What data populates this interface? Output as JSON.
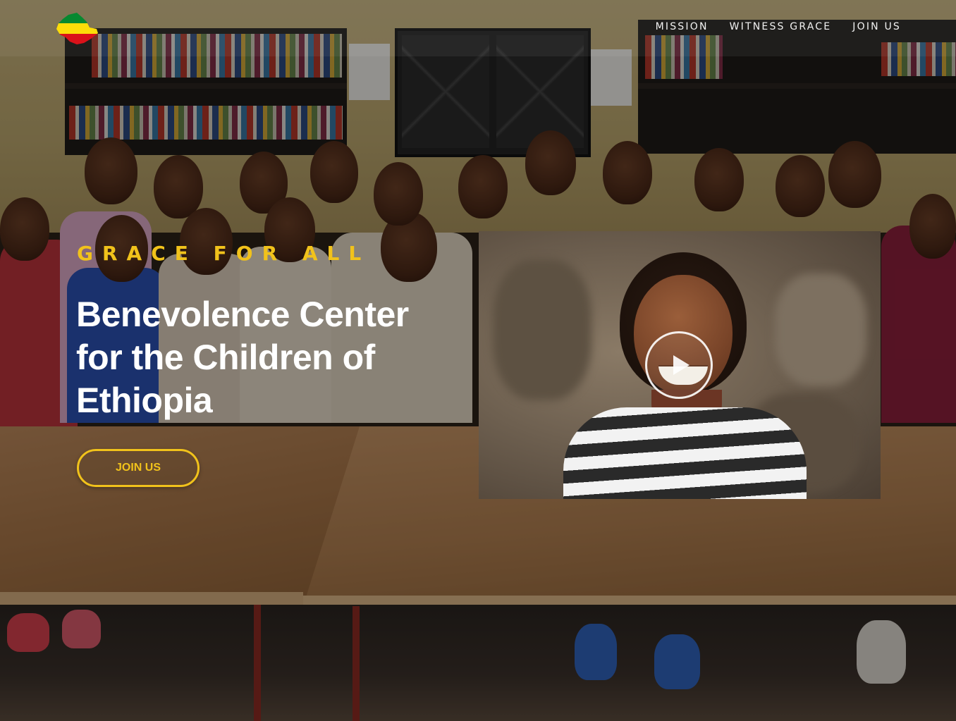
{
  "nav": {
    "items": [
      {
        "label": "MISSION"
      },
      {
        "label": "WITNESS GRACE"
      },
      {
        "label": "JOIN US"
      }
    ]
  },
  "hero": {
    "eyebrow": "GRACE FOR ALL",
    "headline": "Benevolence Center for the Children of Ethiopia",
    "cta_label": "JOIN US"
  },
  "video": {
    "icon": "play-icon"
  },
  "colors": {
    "accent_yellow": "#f1c21b",
    "flag_green": "#078930",
    "flag_yellow": "#fcdd09",
    "flag_red": "#da121a"
  }
}
